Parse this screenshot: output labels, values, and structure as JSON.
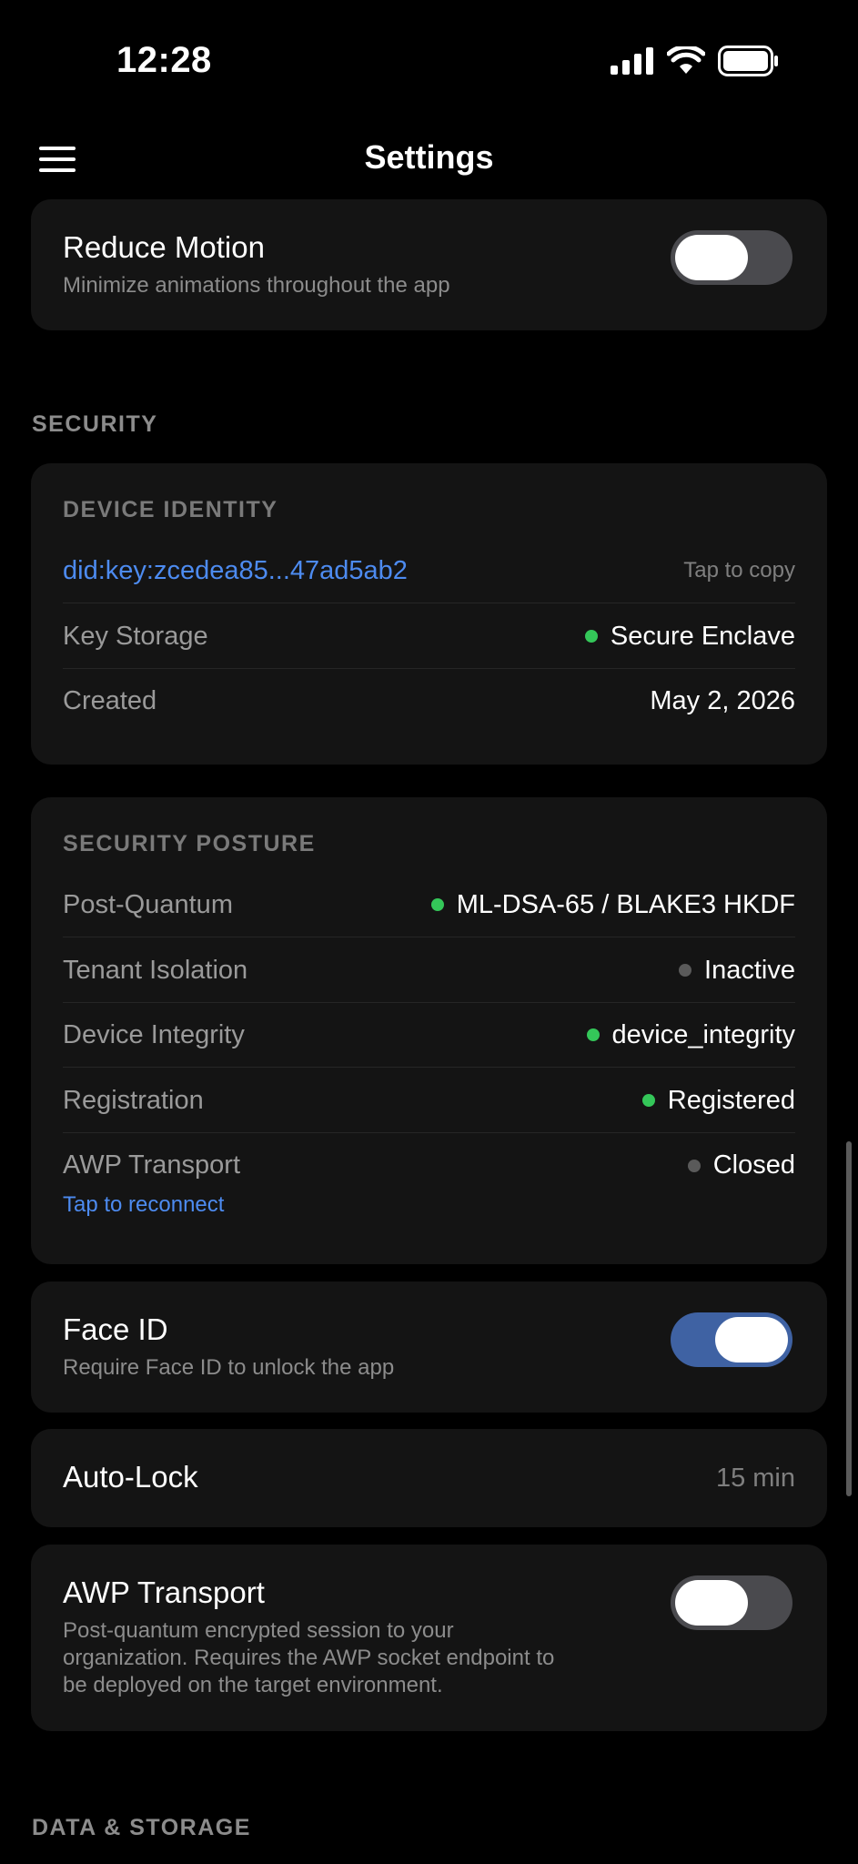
{
  "status_bar": {
    "time": "12:28"
  },
  "nav": {
    "title": "Settings"
  },
  "reduce_motion": {
    "title": "Reduce Motion",
    "subtitle": "Minimize animations throughout the app",
    "enabled": false
  },
  "security_section": {
    "header": "SECURITY"
  },
  "device_identity": {
    "header": "DEVICE IDENTITY",
    "did": "did:key:zcedea85...47ad5ab2",
    "copy_hint": "Tap to copy",
    "rows": [
      {
        "label": "Key Storage",
        "value": "Secure Enclave",
        "status": "green"
      },
      {
        "label": "Created",
        "value": "May 2, 2026"
      }
    ]
  },
  "security_posture": {
    "header": "SECURITY POSTURE",
    "rows": [
      {
        "label": "Post-Quantum",
        "value": "ML-DSA-65 / BLAKE3 HKDF",
        "status": "green"
      },
      {
        "label": "Tenant Isolation",
        "value": "Inactive",
        "status": "gray"
      },
      {
        "label": "Device Integrity",
        "value": "device_integrity",
        "status": "green"
      },
      {
        "label": "Registration",
        "value": "Registered",
        "status": "green"
      },
      {
        "label": "AWP Transport",
        "value": "Closed",
        "status": "gray"
      }
    ],
    "reconnect_label": "Tap to reconnect"
  },
  "face_id": {
    "title": "Face ID",
    "subtitle": "Require Face ID to unlock the app",
    "enabled": true
  },
  "auto_lock": {
    "title": "Auto-Lock",
    "value": "15 min"
  },
  "awp_transport": {
    "title": "AWP Transport",
    "subtitle_lines": [
      "Post-quantum encrypted session to your",
      "organization. Requires the AWP socket endpoint to",
      "be deployed on the target environment."
    ],
    "enabled": false
  },
  "data_storage_section": {
    "header": "DATA & STORAGE"
  },
  "colors": {
    "accent_link": "#4d8bf0",
    "toggle_on": "#3f62a3",
    "status_green": "#34c759",
    "status_gray": "#5a5a5a"
  }
}
